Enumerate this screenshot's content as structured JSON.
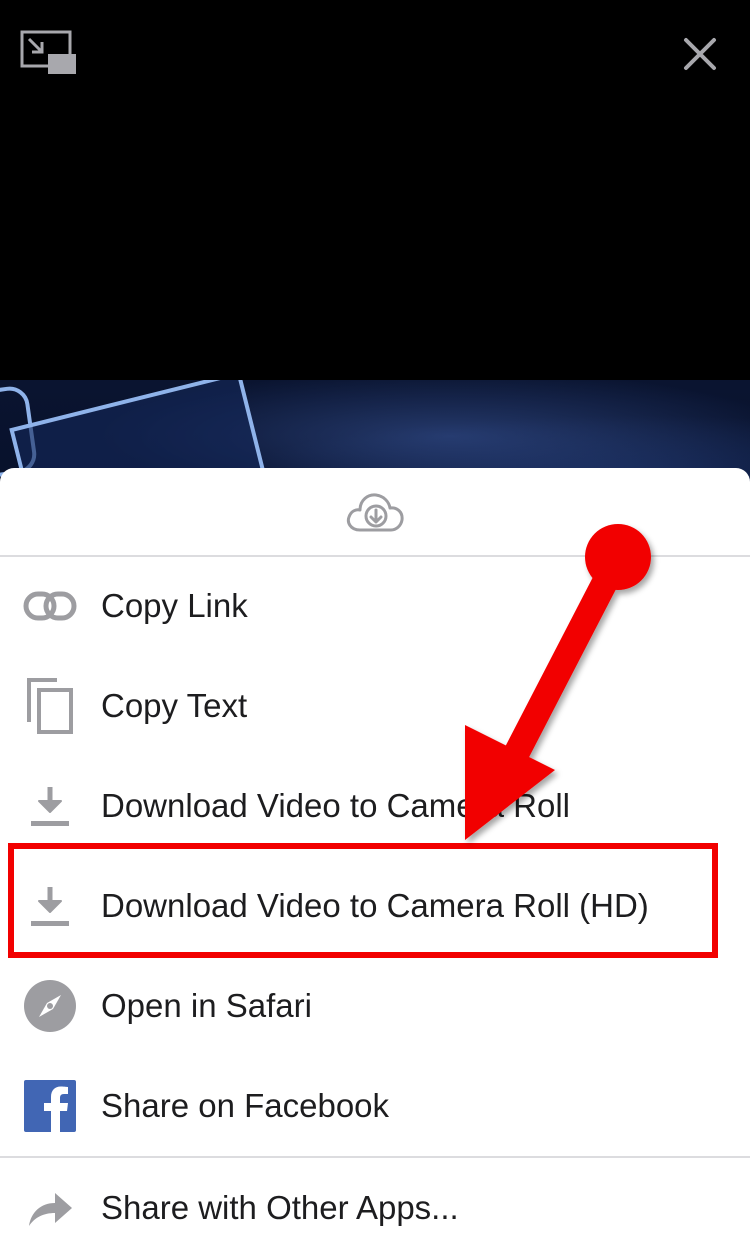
{
  "menu": {
    "items": [
      {
        "label": "Copy Link",
        "icon": "link-icon"
      },
      {
        "label": "Copy Text",
        "icon": "copy-icon"
      },
      {
        "label": "Download Video to Camera Roll",
        "icon": "download-icon"
      },
      {
        "label": "Download Video to Camera Roll (HD)",
        "icon": "download-icon"
      },
      {
        "label": "Open in Safari",
        "icon": "safari-compass-icon"
      },
      {
        "label": "Share on Facebook",
        "icon": "facebook-icon"
      },
      {
        "label": "Share with Other Apps...",
        "icon": "share-arrow-icon"
      }
    ]
  },
  "colors": {
    "icon_gray": "#9d9da1",
    "annotation_red": "#f20000",
    "facebook_blue": "#4166b4",
    "text": "#1d1d1f"
  }
}
